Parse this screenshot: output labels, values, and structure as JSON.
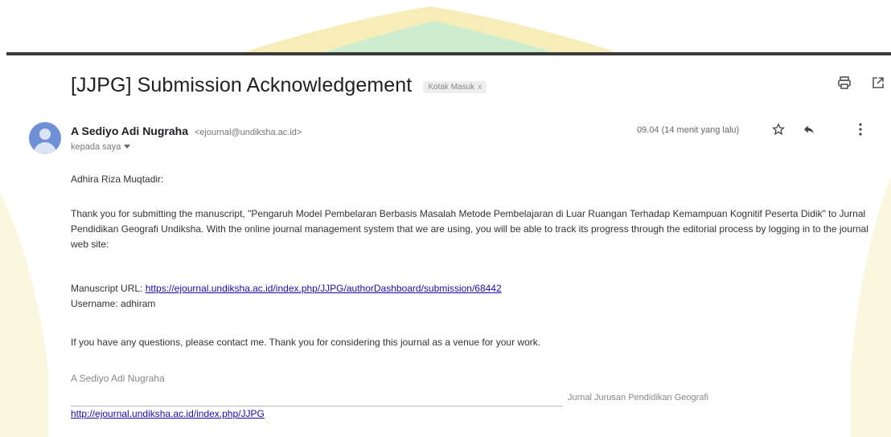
{
  "email": {
    "subject": "[JJPG] Submission Acknowledgement",
    "label": "Kotak Masuk",
    "label_close": "x",
    "sender_name": "A Sediyo Adi Nugraha",
    "sender_email": "<ejournal@undiksha.ac.id>",
    "recipient": "kepada saya",
    "time": "09.04 (14 menit yang lalu)",
    "greeting": "Adhira Riza Muqtadir:",
    "paragraph": "Thank you for submitting the manuscript, \"Pengaruh Model Pembelaran Berbasis Masalah Metode Pembelajaran di Luar Ruangan Terhadap Kemampuan Kognitif Peserta Didik\" to Jurnal Pendidikan Geografi Undiksha. With the online journal management system that we are using, you will be able to track its progress through the editorial process by logging in to the journal web site:",
    "manuscript_label": "Manuscript URL: ",
    "manuscript_url": "https://ejournal.undiksha.ac.id/index.php/JJPG/authorDashboard/submission/68442",
    "username_line": "Username: adhiram",
    "questions": "If you have any questions, please contact me. Thank you for considering this journal as a venue for your work.",
    "signature_name": "A Sediyo Adi Nugraha",
    "signature_journal": "Jurnal Jurusan Pendidikan Geografi",
    "signature_link": "http://ejournal.undiksha.ac.id/index.php/JJPG"
  },
  "icons": {
    "print": "print-icon",
    "open_new": "open-in-new-window-icon",
    "star": "star-icon",
    "reply": "reply-icon",
    "more": "more-vertical-icon",
    "dropdown": "chevron-down-icon",
    "avatar": "avatar"
  },
  "colors": {
    "link": "#1a0dab",
    "avatar": "#6f8fd6",
    "watermark_yellow": "#f3e8a8",
    "watermark_green": "#bfe8cc"
  }
}
